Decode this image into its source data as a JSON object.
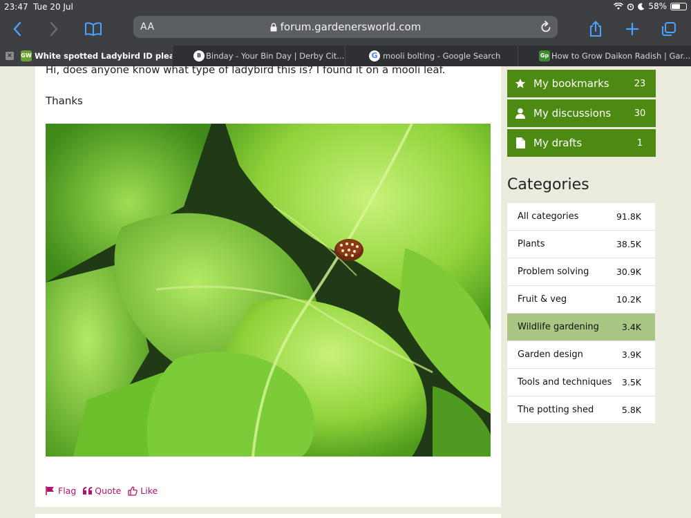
{
  "status": {
    "time": "23:47",
    "date": "Tue 20 Jul",
    "battery": "58%",
    "battery_level": 0.58
  },
  "browser": {
    "text_size_label": "AA",
    "url": "forum.gardenersworld.com",
    "accent": "#4aa3ff"
  },
  "tabs": [
    {
      "title": "White spotted Ladybird ID pleas...",
      "favicon": "GW",
      "active": true
    },
    {
      "title": "Binday - Your Bin Day | Derby Cit...",
      "favicon": "B"
    },
    {
      "title": "mooli bolting - Google Search",
      "favicon": "G"
    },
    {
      "title": "How to Grow Daikon Radish | Gar...",
      "favicon": "Gp"
    }
  ],
  "post": {
    "body_line1": "Hi, does anyone know what type of ladybird this is? I found it on a mooli leaf.",
    "body_line2": "Thanks",
    "actions": {
      "flag": "Flag",
      "quote": "Quote",
      "like": "Like"
    },
    "action_color": "#b0126a"
  },
  "sidebar": {
    "buttons": [
      {
        "label": "My bookmarks",
        "count": "23",
        "icon": "star-icon"
      },
      {
        "label": "My discussions",
        "count": "30",
        "icon": "user-icon"
      },
      {
        "label": "My drafts",
        "count": "1",
        "icon": "file-icon"
      }
    ],
    "categories_title": "Categories",
    "categories": [
      {
        "name": "All categories",
        "count": "91.8K"
      },
      {
        "name": "Plants",
        "count": "38.5K"
      },
      {
        "name": "Problem solving",
        "count": "30.9K"
      },
      {
        "name": "Fruit & veg",
        "count": "10.2K"
      },
      {
        "name": "Wildlife gardening",
        "count": "3.4K",
        "active": true
      },
      {
        "name": "Garden design",
        "count": "3.9K"
      },
      {
        "name": "Tools and techniques",
        "count": "3.5K"
      },
      {
        "name": "The potting shed",
        "count": "5.8K"
      }
    ],
    "brand_green": "#4c8a12",
    "active_green": "#a9c684"
  }
}
